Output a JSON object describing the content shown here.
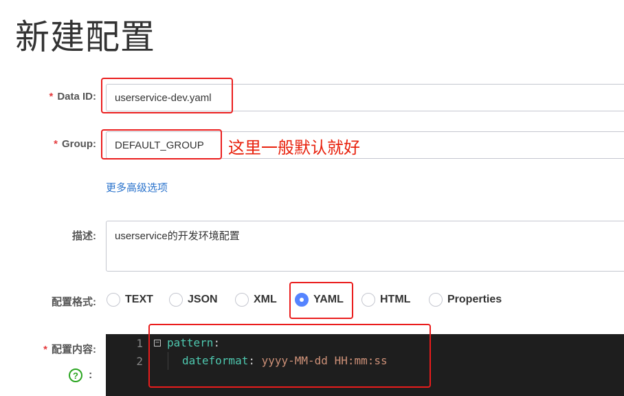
{
  "page": {
    "title": "新建配置"
  },
  "form": {
    "data_id": {
      "required_mark": "*",
      "label": "Data ID:",
      "value": "userservice-dev.yaml"
    },
    "group": {
      "required_mark": "*",
      "label": "Group:",
      "value": "DEFAULT_GROUP",
      "annotation": "这里一般默认就好"
    },
    "advanced_link": "更多高级选项",
    "description": {
      "label": "描述:",
      "value": "userservice的开发环境配置"
    },
    "format": {
      "label": "配置格式:",
      "options": [
        "TEXT",
        "JSON",
        "XML",
        "YAML",
        "HTML",
        "Properties"
      ],
      "selected": "YAML"
    },
    "content": {
      "required_mark": "*",
      "label": "配置内容:",
      "help_icon": "question-circle-icon",
      "help_colon": ":",
      "fold_icon": "minus-square-icon",
      "fold_glyph": "−",
      "lines": [
        {
          "number": "1",
          "key": "pattern",
          "colon": ":",
          "value": ""
        },
        {
          "number": "2",
          "key": "dateformat",
          "colon": ":",
          "value": "yyyy-MM-dd HH:mm:ss"
        }
      ]
    }
  },
  "colors": {
    "highlight_box": "#ea1c1c",
    "required": "#e4393c",
    "link": "#2a73cc",
    "radio_selected": "#5584ff",
    "editor_bg": "#1e1e1e",
    "help_icon": "#2aa520"
  }
}
